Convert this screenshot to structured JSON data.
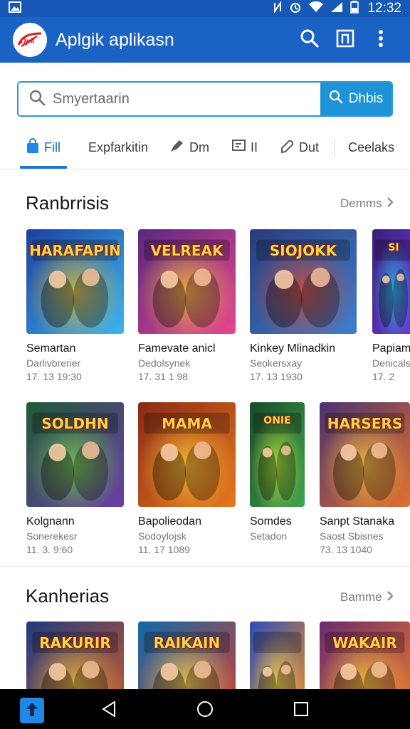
{
  "status_bar": {
    "time": "12:32",
    "icons": [
      "image-icon",
      "nfc-icon",
      "alarm-icon",
      "wifi-icon",
      "signal-icon",
      "battery-icon"
    ]
  },
  "app_bar": {
    "logo_text": "Dpk",
    "title": "Aplgik aplikasn",
    "actions": [
      "search-icon",
      "tab-switch-icon",
      "more-vert-icon"
    ]
  },
  "search": {
    "placeholder": "Smyertaarin",
    "button_label": "Dhbis"
  },
  "tabs": [
    {
      "label": "Fill",
      "icon": "bag-icon",
      "active": true
    },
    {
      "label": "Expfarkitin",
      "icon": "",
      "active": false
    },
    {
      "label": "Dm",
      "icon": "pen-icon",
      "active": false
    },
    {
      "label": "II",
      "icon": "flag-icon",
      "active": false
    },
    {
      "label": "Dut",
      "icon": "tag-icon",
      "active": false
    },
    {
      "label": "Ceelaks",
      "icon": "",
      "active": false
    }
  ],
  "sections": [
    {
      "title": "Ranbrrisis",
      "see_more": "Demms",
      "rows": [
        [
          {
            "name": "Semartan",
            "dev": "Darlivbrerier",
            "meta": "17. 13 19:30",
            "art": "HARAFAPIN",
            "colors": [
              "#1d3f9e",
              "#3bb6f0",
              "#f4c31f"
            ]
          },
          {
            "name": "Famevate anicl",
            "dev": "Dedolsynek",
            "meta": "17. 31 1 98",
            "art": "VELREAK",
            "colors": [
              "#5a2780",
              "#e8478d",
              "#ffcd2e"
            ]
          },
          {
            "name": "Kinkey Mlinadkin",
            "dev": "Seokersxay",
            "meta": "17. 13 1930",
            "art": "SIOJOKK",
            "colors": [
              "#2b3b7a",
              "#3e7fcf",
              "#e84b2b"
            ]
          },
          {
            "name": "Papiam",
            "dev": "Denicals",
            "meta": "17. 2",
            "art": "SI",
            "colors": [
              "#3a1f7a",
              "#6b3bd8",
              "#25d0f0"
            ]
          }
        ],
        [
          {
            "name": "Kolgnann",
            "dev": "Sonerekesr",
            "meta": "11. 3. 9:60",
            "art": "SOLDHN",
            "colors": [
              "#1f5a35",
              "#6b3ca8",
              "#7ed94a"
            ]
          },
          {
            "name": "Bapolieodan",
            "dev": "Sodoylojsk",
            "meta": "11. 17 1089",
            "art": "MAMA",
            "colors": [
              "#8a2a16",
              "#e7771e",
              "#ffd23a"
            ]
          },
          {
            "name": "Somdes",
            "dev": "Setadon",
            "meta": "",
            "art": "ONIE",
            "colors": [
              "#1a4a2a",
              "#3fa34d",
              "#c9f03a"
            ]
          },
          {
            "name": "Sanpt Stanaka",
            "dev": "Saost Sbisnes",
            "meta": "73. 13 1040",
            "art": "HARSERS",
            "colors": [
              "#4a3170",
              "#e26f2e",
              "#ffce3a"
            ]
          }
        ]
      ]
    },
    {
      "title": "Kanherias",
      "see_more": "Bamme",
      "rows": [
        [
          {
            "name": "",
            "dev": "",
            "meta": "",
            "art": "RAKURIR",
            "colors": [
              "#1f3b80",
              "#d0582a",
              "#f3c63a"
            ]
          },
          {
            "name": "",
            "dev": "",
            "meta": "",
            "art": "RAIKAIN",
            "colors": [
              "#0e6aa8",
              "#d83b30",
              "#ffe04a"
            ]
          },
          {
            "name": "",
            "dev": "",
            "meta": "",
            "art": "",
            "colors": [
              "#2a4fb8",
              "#f08c25",
              "#ffdf4a"
            ]
          },
          {
            "name": "",
            "dev": "",
            "meta": "",
            "art": "WAKAIR",
            "colors": [
              "#6a2a6e",
              "#f07a2a",
              "#ffd03a"
            ]
          }
        ]
      ]
    }
  ],
  "nav_bar": {
    "buttons": [
      "back-icon",
      "home-icon",
      "recents-icon"
    ]
  },
  "colors": {
    "primary": "#1a62c4",
    "accent": "#1f93d8",
    "status_bar": "#1559b5"
  }
}
